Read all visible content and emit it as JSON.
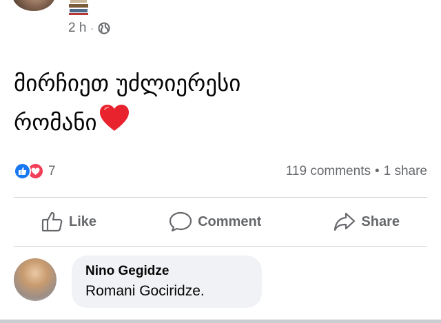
{
  "post": {
    "time": "2 h",
    "separator": "·",
    "text_line1": "მირჩიეთ უძლიერესი",
    "text_line2": "რომანი",
    "heart_icon": "heart-emoji"
  },
  "reactions": {
    "count": "7",
    "comments": "119 comments",
    "dot": "•",
    "shares": "1 share",
    "colors": {
      "like": "#1877f2",
      "love": "#f33e58"
    }
  },
  "actions": {
    "like": "Like",
    "comment": "Comment",
    "share": "Share"
  },
  "comment": {
    "author": "Nino Gegidze",
    "text": "Romani Gociridze."
  }
}
